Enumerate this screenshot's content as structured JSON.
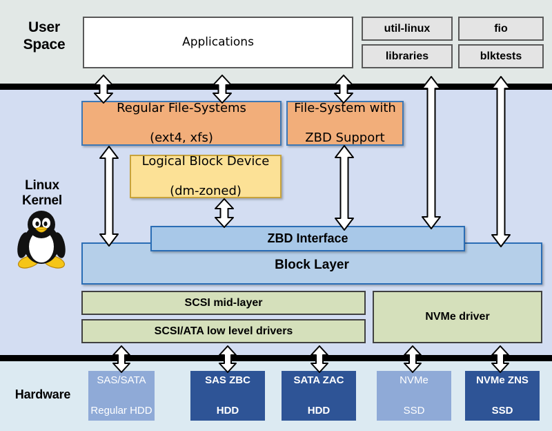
{
  "bands": {
    "user_space_label": "User\nSpace",
    "kernel_label": "Linux\nKernel",
    "hardware_label": "Hardware"
  },
  "user_space": {
    "applications": "Applications",
    "tools": [
      {
        "label": "util-linux"
      },
      {
        "label": "fio"
      },
      {
        "label": "libraries"
      },
      {
        "label": "blktests"
      }
    ]
  },
  "kernel": {
    "regular_fs_line1": "Regular File-Systems",
    "regular_fs_line2": "(ext4, xfs)",
    "zbd_fs_line1": "File-System with",
    "zbd_fs_line2": "ZBD Support",
    "dm_line1": "Logical Block Device",
    "dm_line2": "(dm-zoned)",
    "zbd_interface": "ZBD Interface",
    "block_layer": "Block Layer",
    "scsi_mid": "SCSI mid-layer",
    "scsi_low": "SCSI/ATA low level drivers",
    "nvme_driver": "NVMe driver",
    "logo_name": "tux-penguin-logo"
  },
  "hardware": {
    "devices": [
      {
        "line1": "SAS/SATA",
        "line2": "Regular HDD",
        "style": "light"
      },
      {
        "line1": "SAS ZBC",
        "line2": "HDD",
        "style": "dark"
      },
      {
        "line1": "SATA ZAC",
        "line2": "HDD",
        "style": "dark"
      },
      {
        "line1": "NVMe",
        "line2": "SSD",
        "style": "light"
      },
      {
        "line1": "NVMe ZNS",
        "line2": "SSD",
        "style": "dark"
      }
    ]
  },
  "colors": {
    "user_band": "#e2e8e6",
    "kernel_band": "#d3ddf2",
    "hardware_band": "#dceaf2",
    "filesystem_orange": "#f2ae7a",
    "dm_yellow": "#fce196",
    "block_blue": "#b5cfe9",
    "zbd_blue": "#a8c8e8",
    "driver_green": "#d5e0bb",
    "hw_light_blue": "#8faad7",
    "hw_dark_blue": "#2e5496",
    "divider": "#000000"
  }
}
